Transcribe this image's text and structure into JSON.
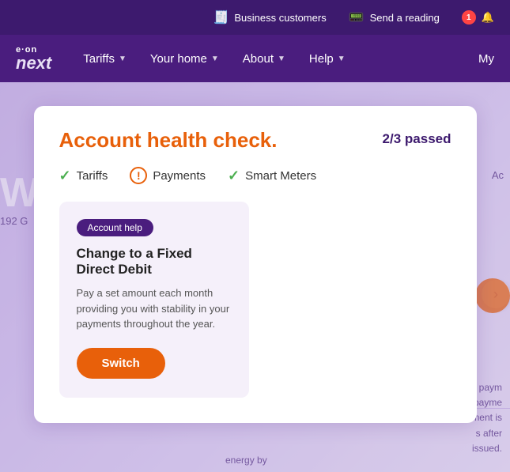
{
  "topbar": {
    "business_customers_label": "Business customers",
    "send_reading_label": "Send a reading",
    "notification_count": "1"
  },
  "navbar": {
    "logo_eon": "e·on",
    "logo_next": "next",
    "tariffs_label": "Tariffs",
    "your_home_label": "Your home",
    "about_label": "About",
    "help_label": "Help",
    "my_label": "My"
  },
  "modal": {
    "title": "Account health check.",
    "passed_label": "2/3 passed",
    "checks": [
      {
        "label": "Tariffs",
        "status": "pass"
      },
      {
        "label": "Payments",
        "status": "warn"
      },
      {
        "label": "Smart Meters",
        "status": "pass"
      }
    ]
  },
  "card": {
    "tag_label": "Account help",
    "title": "Change to a Fixed Direct Debit",
    "description": "Pay a set amount each month providing you with stability in your payments throughout the year.",
    "switch_button_label": "Switch"
  },
  "background": {
    "we_text": "We",
    "address_text": "192 G",
    "account_text": "Ac",
    "right_payment_label": "t paym",
    "right_payment_desc1": "payme",
    "right_payment_desc2": "ment is",
    "right_payment_desc3": "s after",
    "right_payment_desc4": "issued.",
    "energy_text": "energy by"
  }
}
